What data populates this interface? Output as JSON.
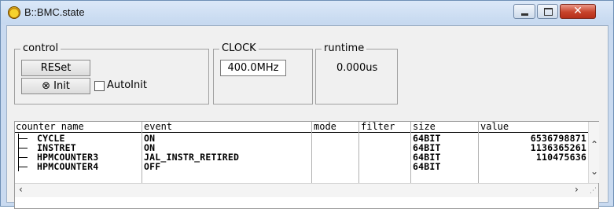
{
  "window": {
    "title": "B::BMC.state"
  },
  "control": {
    "group_title": "control",
    "reset_label": "RESet",
    "init_label": "Init",
    "autoinit_label": "AutoInit",
    "autoinit_checked": false
  },
  "clock": {
    "group_title": "CLOCK",
    "value": "400.0MHz"
  },
  "runtime": {
    "group_title": "runtime",
    "value": "0.000us"
  },
  "table": {
    "columns": [
      "counter name",
      "event",
      "mode",
      "filter",
      "size",
      "value"
    ],
    "rows": [
      {
        "name": "CYCLE",
        "event": "ON",
        "mode": "",
        "filter": "",
        "size": "64BIT",
        "value": "6536798871"
      },
      {
        "name": "INSTRET",
        "event": "ON",
        "mode": "",
        "filter": "",
        "size": "64BIT",
        "value": "1136365261"
      },
      {
        "name": "HPMCOUNTER3",
        "event": "JAL_INSTR_RETIRED",
        "mode": "",
        "filter": "",
        "size": "64BIT",
        "value": "110475636"
      },
      {
        "name": "HPMCOUNTER4",
        "event": "OFF",
        "mode": "",
        "filter": "",
        "size": "64BIT",
        "value": ""
      }
    ]
  }
}
